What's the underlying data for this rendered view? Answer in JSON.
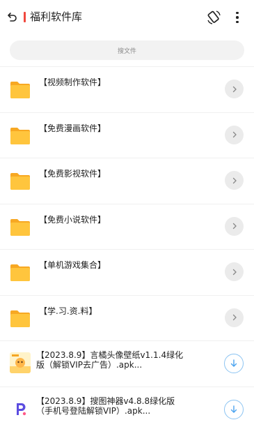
{
  "header": {
    "title": "福利软件库",
    "back_icon": "back-arrow-icon",
    "accent_color": "#f0483e",
    "action_icon": "rotate-device-icon",
    "more_icon": "more-vertical-icon"
  },
  "search": {
    "placeholder": "搜文件"
  },
  "folders": [
    {
      "name": "【视频制作软件】",
      "icon": "folder-icon"
    },
    {
      "name": "【免费漫画软件】",
      "icon": "folder-icon"
    },
    {
      "name": "【免费影视软件】",
      "icon": "folder-icon"
    },
    {
      "name": "【免费小说软件】",
      "icon": "folder-icon"
    },
    {
      "name": "【单机游戏集合】",
      "icon": "folder-icon"
    },
    {
      "name": "【学.习.资.料】",
      "icon": "folder-icon"
    }
  ],
  "files": [
    {
      "name": "【2023.8.9】言橘头像壁纸v1.1.4绿化版（解锁VIP去广告）.apk...",
      "icon": "app-thumbnail-icon"
    },
    {
      "name": "【2023.8.9】搜图神器v4.8.8绿化版（手机号登陆解锁VIP）.apk...",
      "icon": "app-thumbnail-icon"
    }
  ],
  "colors": {
    "folder": "#ffc53d",
    "folder_tab": "#f7a823",
    "download": "#4aa3ef"
  }
}
